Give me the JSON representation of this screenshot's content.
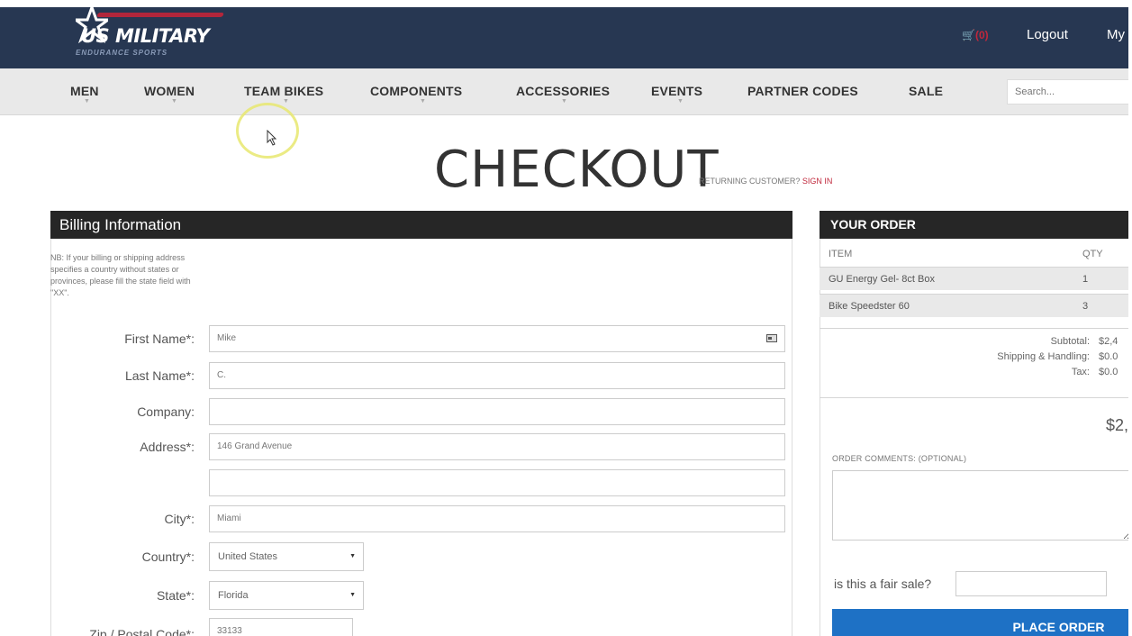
{
  "header": {
    "logo_text": "US MILITARY",
    "logo_sub": "ENDURANCE SPORTS",
    "cart_text": "(0)",
    "logout_label": "Logout",
    "my_label": "My"
  },
  "nav": {
    "items": [
      {
        "label": "MEN"
      },
      {
        "label": "WOMEN"
      },
      {
        "label": "TEAM BIKES"
      },
      {
        "label": "COMPONENTS"
      },
      {
        "label": "ACCESSORIES"
      },
      {
        "label": "EVENTS"
      },
      {
        "label": "PARTNER CODES"
      },
      {
        "label": "SALE"
      }
    ],
    "search_placeholder": "Search..."
  },
  "page": {
    "title": "CHECKOUT",
    "returning_text": "RETURNING CUSTOMER?",
    "sign_in_label": "SIGN IN"
  },
  "billing": {
    "heading": "Billing Information",
    "note": "NB: If your billing or shipping address specifies a country without states or provinces, please fill the state field with \"XX\".",
    "fields": {
      "first_name_label": "First Name*:",
      "first_name_value": "Mike",
      "last_name_label": "Last Name*:",
      "last_name_value": "C.",
      "company_label": "Company:",
      "company_value": "",
      "address_label": "Address*:",
      "address_value": "146 Grand Avenue",
      "address2_value": "",
      "city_label": "City*:",
      "city_value": "Miami",
      "country_label": "Country*:",
      "country_value": "United States",
      "state_label": "State*:",
      "state_value": "Florida",
      "zip_label": "Zip / Postal Code*:",
      "zip_value": "33133"
    }
  },
  "order": {
    "heading": "YOUR ORDER",
    "col_item": "ITEM",
    "col_qty": "QTY",
    "items": [
      {
        "name": "GU Energy Gel- 8ct Box",
        "qty": "1"
      },
      {
        "name": "Bike Speedster 60",
        "qty": "3"
      }
    ],
    "subtotal_label": "Subtotal:",
    "subtotal_value": "$2,4",
    "shipping_label": "Shipping & Handling:",
    "shipping_value": "$0.0",
    "tax_label": "Tax:",
    "tax_value": "$0.0",
    "grand_total": "$2,",
    "comments_label": "ORDER COMMENTS: (OPTIONAL)",
    "fair_sale_label": "is this a fair sale?",
    "place_order_label": "PLACE ORDER"
  },
  "colors": {
    "header_bg": "#273752",
    "nav_bg": "#e9e9e9",
    "accent_red": "#c0283c",
    "button_blue": "#1e71c5"
  }
}
